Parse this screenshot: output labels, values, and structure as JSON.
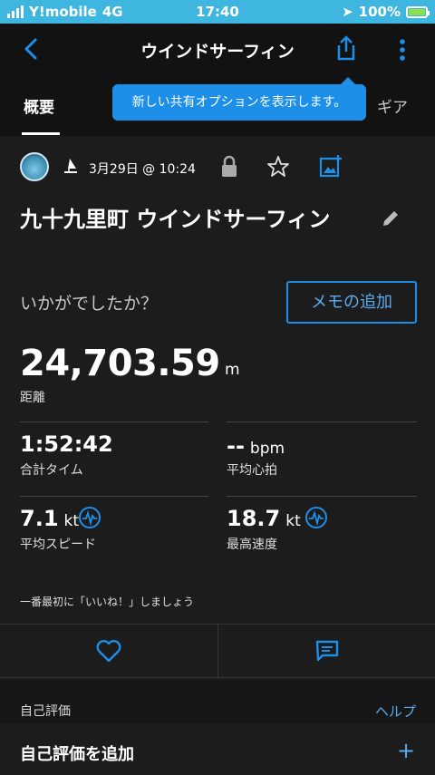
{
  "status_bar": {
    "carrier": "Y!mobile",
    "network": "4G",
    "time": "17:40",
    "battery": "100%"
  },
  "header": {
    "title": "ウインドサーフィン"
  },
  "tabs": {
    "overview": "概要",
    "gear": "ギア"
  },
  "tooltip": {
    "text": "新しい共有オプションを表示します。"
  },
  "activity": {
    "date": "3月29日 @ 10:24",
    "name": "九十九里町 ウインドサーフィン",
    "how_did_it_go": "いかがでしたか？",
    "add_memo": "メモの追加"
  },
  "stats": {
    "distance": {
      "value": "24,703.59",
      "unit": "m",
      "label": "距離"
    },
    "total_time": {
      "value": "1:52:42",
      "label": "合計タイム"
    },
    "avg_hr": {
      "value": "--",
      "unit": "bpm",
      "label": "平均心拍"
    },
    "avg_speed": {
      "value": "7.1",
      "unit": "kt",
      "label": "平均スピード"
    },
    "max_speed": {
      "value": "18.7",
      "unit": "kt",
      "label": "最高速度"
    }
  },
  "social": {
    "like_prompt": "一番最初に「いいね！」しましょう"
  },
  "self_eval": {
    "title": "自己評価",
    "help": "ヘルプ",
    "add_label": "自己評価を追加",
    "add_icon": "+"
  },
  "colors": {
    "accent": "#1e8fe8",
    "status_bar": "#3fb6e0",
    "background": "#1c1c1c"
  }
}
